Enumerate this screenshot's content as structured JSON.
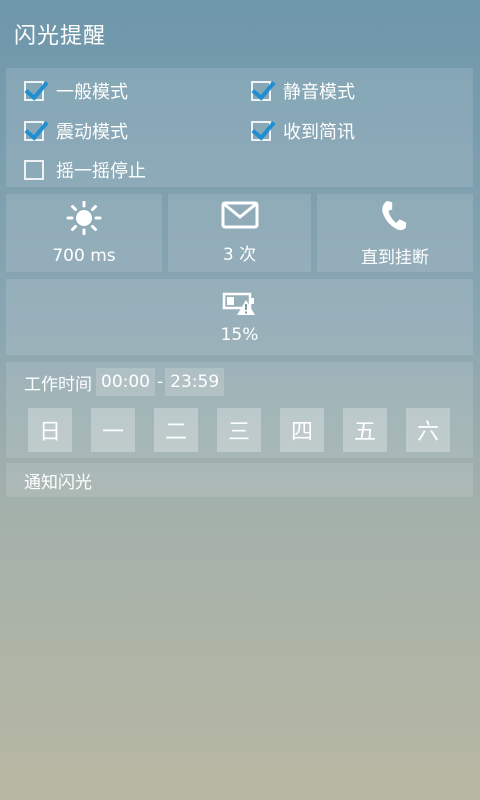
{
  "app": {
    "title": "闪光提醒"
  },
  "modes": {
    "normal": {
      "label": "一般模式",
      "checked": true
    },
    "silent": {
      "label": "静音模式",
      "checked": true
    },
    "vibrate": {
      "label": "震动模式",
      "checked": true
    },
    "sms": {
      "label": "收到简讯",
      "checked": true
    },
    "shake": {
      "label": "摇一摇停止",
      "checked": false
    }
  },
  "settings": {
    "duration": {
      "icon": "sun-icon",
      "value": "700 ms"
    },
    "count": {
      "icon": "envelope-icon",
      "value": "3 次"
    },
    "until": {
      "icon": "phone-icon",
      "value": "直到挂断"
    },
    "battery": {
      "icon": "low-battery-warning-icon",
      "value": "15%"
    }
  },
  "work": {
    "label": "工作时间",
    "start": "00:00",
    "separator": "-",
    "end": "23:59",
    "days": [
      "日",
      "一",
      "二",
      "三",
      "四",
      "五",
      "六"
    ]
  },
  "notify": {
    "label": "通知闪光"
  },
  "colors": {
    "accent": "#1f8fd2"
  }
}
